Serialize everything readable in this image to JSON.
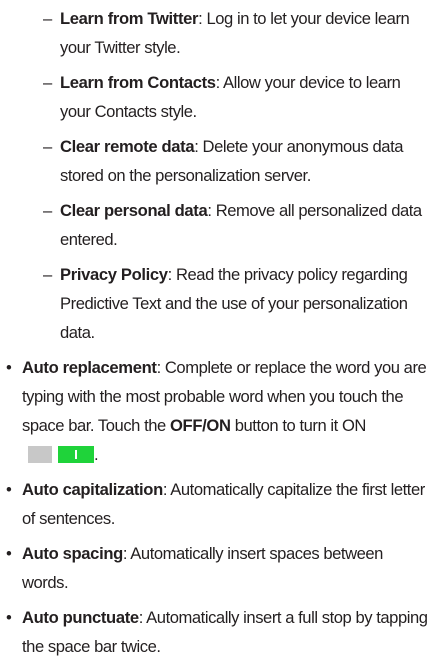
{
  "sub_items": [
    {
      "dash": "–",
      "term": "Learn from Twitter",
      "text": ": Log in to let your device learn your Twitter style."
    },
    {
      "dash": "–",
      "term": "Learn from Contacts",
      "text": ": Allow your device to learn your Contacts style."
    },
    {
      "dash": "–",
      "term": "Clear remote data",
      "text": ": Delete your anonymous data stored on the personalization server."
    },
    {
      "dash": "–",
      "term": "Clear personal data",
      "text": ": Remove all personalized data entered."
    },
    {
      "dash": "–",
      "term": "Privacy Policy",
      "text": ": Read the privacy policy regarding Predictive Text and the use of your personalization data."
    }
  ],
  "main_items": [
    {
      "bullet": "•",
      "term": "Auto replacement",
      "text_before": ": Complete or replace the word you are typing with the most probable word when you touch the space bar. Touch the ",
      "button_label": "OFF/ON",
      "text_after": " button to turn it ON",
      "end": "."
    },
    {
      "bullet": "•",
      "term": "Auto capitalization",
      "text": ": Automatically capitalize the first letter of sentences."
    },
    {
      "bullet": "•",
      "term": "Auto spacing",
      "text": ": Automatically insert spaces between words."
    },
    {
      "bullet": "•",
      "term": "Auto punctuate",
      "text": ": Automatically insert a full stop by tapping the space bar twice."
    }
  ],
  "toggle": {
    "state": "on",
    "off_color": "#c8c8c8",
    "on_color": "#1fd33a"
  }
}
